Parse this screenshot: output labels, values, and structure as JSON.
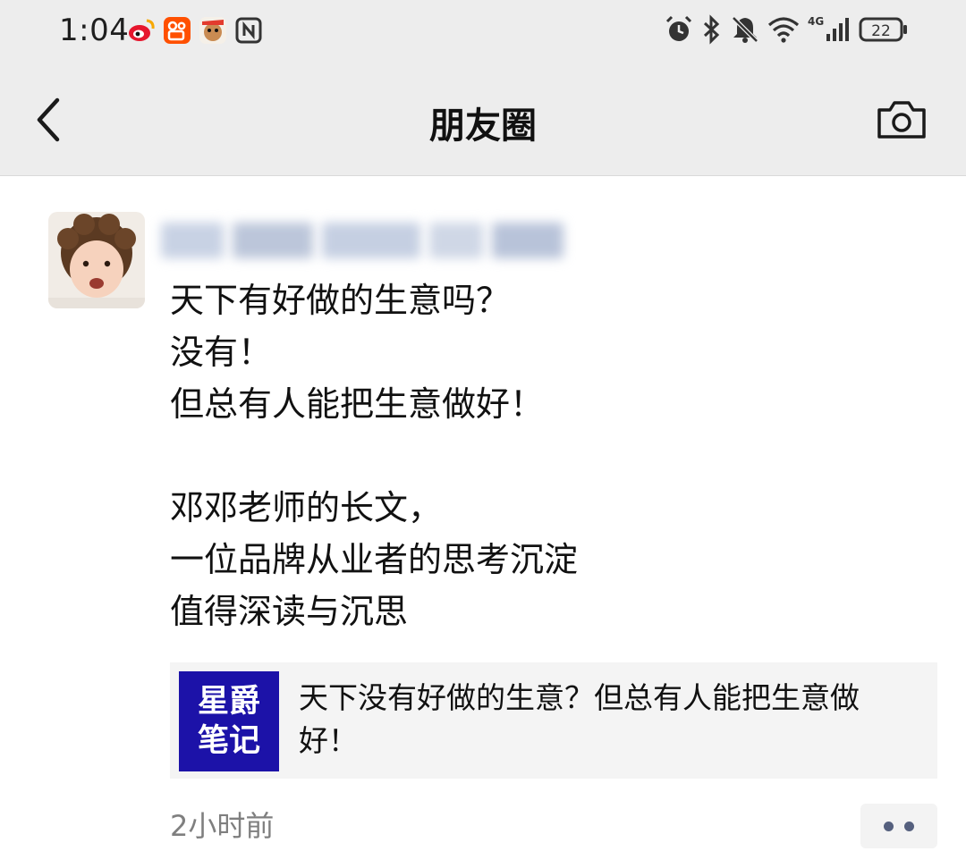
{
  "status_bar": {
    "time": "1:04",
    "left_icons": [
      "weibo-icon",
      "kuaishou-icon",
      "news-app-icon",
      "nfc-icon"
    ],
    "right_icons": [
      "alarm-icon",
      "bluetooth-icon",
      "mute-icon",
      "wifi-icon",
      "signal-4g-icon"
    ],
    "network_label": "4G",
    "battery": "22"
  },
  "nav": {
    "title": "朋友圈",
    "back_icon": "chevron-left-icon",
    "camera_icon": "camera-icon"
  },
  "post": {
    "lines": [
      "天下有好做的生意吗？",
      "没有！",
      "但总有人能把生意做好！",
      "",
      "邓邓老师的长文，",
      "一位品牌从业者的思考沉淀",
      "值得深读与沉思"
    ],
    "link": {
      "thumb_line1": "星爵",
      "thumb_line2": "笔记",
      "title": "天下没有好做的生意？但总有人能把生意做好！"
    },
    "time": "2小时前"
  },
  "colors": {
    "header_bg": "#ededed",
    "link_card_bg": "#f4f4f4",
    "thumb_bg": "#1c12a8",
    "time_text": "#7f7f7f",
    "more_dots": "#55607e"
  }
}
